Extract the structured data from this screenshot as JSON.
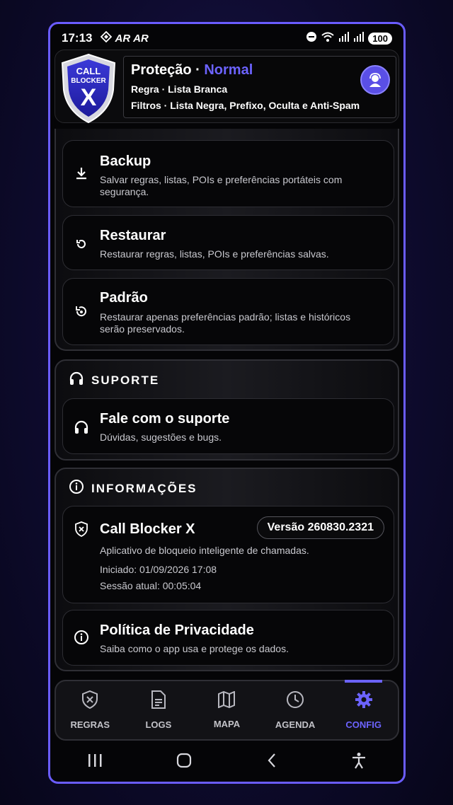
{
  "status": {
    "time": "17:13",
    "left_icons": [
      "diamond-icon",
      "ar-icon",
      "ar-icon"
    ],
    "left_text": [
      "AR",
      "AR"
    ],
    "battery": "100"
  },
  "header": {
    "logo_text_1": "CALL",
    "logo_text_2": "BLOCKER",
    "logo_text_3": "X",
    "title_prefix": "Proteção · ",
    "title_mode": "Normal",
    "line1": "Regra · Lista Branca",
    "line2": "Filtros · Lista Negra, Prefixo, Oculta e Anti-Spam"
  },
  "backup_section": {
    "items": [
      {
        "icon": "download-icon",
        "title": "Backup",
        "sub": "Salvar regras, listas, POIs e preferências portáteis com segurança."
      },
      {
        "icon": "restore-icon",
        "title": "Restaurar",
        "sub": "Restaurar regras, listas, POIs e preferências salvas."
      },
      {
        "icon": "reset-icon",
        "title": "Padrão",
        "sub": "Restaurar apenas preferências padrão; listas e históricos serão preservados."
      }
    ]
  },
  "support": {
    "header": "SUPORTE",
    "item": {
      "title": "Fale com o suporte",
      "sub": "Dúvidas, sugestões e bugs."
    }
  },
  "info": {
    "header": "INFORMAÇÕES",
    "app": {
      "title": "Call Blocker X",
      "version": "Versão 260830.2321",
      "desc": "Aplicativo de bloqueio inteligente de chamadas.",
      "started": "Iniciado: 01/09/2026 17:08",
      "session": "Sessão atual: 00:05:04"
    },
    "privacy": {
      "title": "Política de Privacidade",
      "sub": "Saiba como o app usa e protege os dados."
    }
  },
  "nav": {
    "items": [
      {
        "label": "REGRAS",
        "icon": "shield-x-icon"
      },
      {
        "label": "LOGS",
        "icon": "document-icon"
      },
      {
        "label": "MAPA",
        "icon": "map-icon"
      },
      {
        "label": "AGENDA",
        "icon": "clock-icon"
      },
      {
        "label": "CONFIG",
        "icon": "gear-icon"
      }
    ],
    "active": "CONFIG"
  },
  "colors": {
    "accent": "#6c63ff",
    "frame": "#6a5cff"
  }
}
